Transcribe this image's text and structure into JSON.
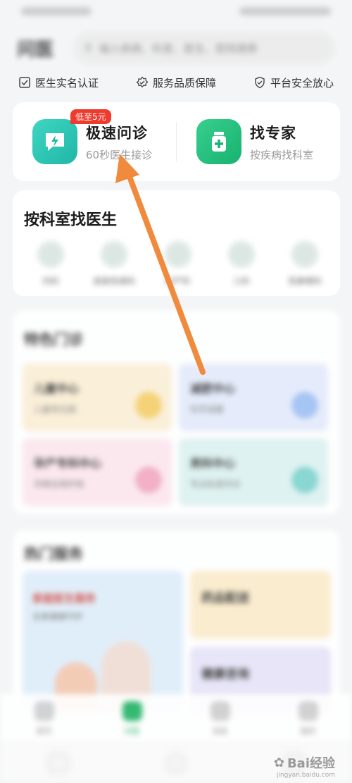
{
  "header": {
    "title": "问医",
    "search_placeholder": "输入疾病、科室、医生、医院搜索"
  },
  "guarantees": [
    "医生实名认证",
    "服务品质保障",
    "平台安全放心"
  ],
  "consult": {
    "fast": {
      "title": "极速问诊",
      "subtitle": "60秒医生接诊",
      "badge": "低至5元"
    },
    "expert": {
      "title": "找专家",
      "subtitle": "按疾病找科室"
    }
  },
  "departments": {
    "heading": "按科室找医生",
    "items": [
      "内科",
      "皮肤性病科",
      "妇产科",
      "儿科",
      "耳鼻喉科"
    ]
  },
  "specialty": {
    "heading": "特色门诊",
    "tiles": [
      {
        "title": "儿童中心",
        "sub": "儿童常见病"
      },
      {
        "title": "减肥中心",
        "sub": "科学减重"
      },
      {
        "title": "孕产专科中心",
        "sub": "孕期全程护航"
      },
      {
        "title": "男科中心",
        "sub": "专业私密问诊"
      }
    ]
  },
  "services": {
    "heading": "热门服务",
    "promo": {
      "title": "家庭医生服务",
      "sub": "全家健康守护"
    },
    "items": [
      "药品配送",
      "健康咨询"
    ]
  },
  "bottom_nav": {
    "items": [
      "首页",
      "问医",
      "消息",
      "我的"
    ],
    "active_index": 1
  },
  "watermark": {
    "text": "Bai经验",
    "sub": "jingyan.baidu.com"
  },
  "colors": {
    "accent_green": "#21b466",
    "teal_icon": "#20b7a7",
    "arrow": "#f08a3c",
    "badge_red": "#ef3b2e"
  }
}
